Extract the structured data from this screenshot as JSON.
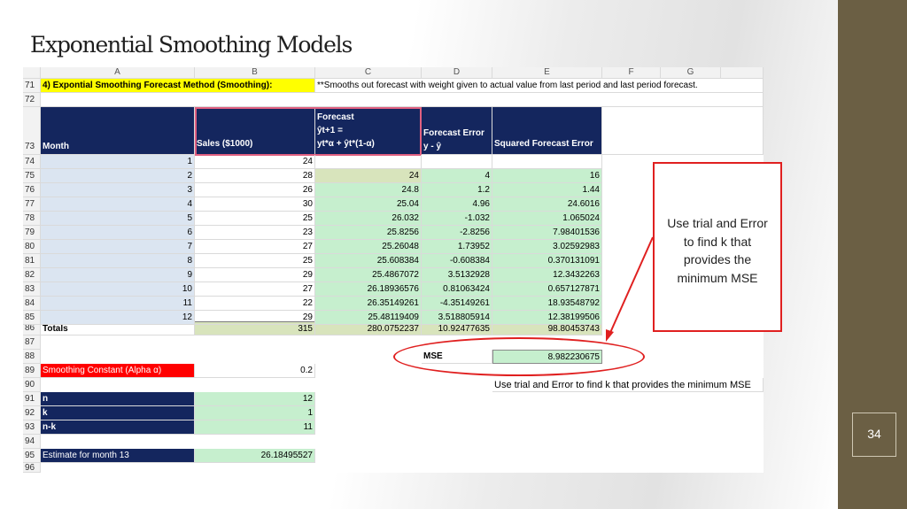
{
  "slide": {
    "title": "Exponential Smoothing Models",
    "page_number": "34",
    "callout_text": "Use trial and Error\nto find k that\nprovides the\nminimum MSE"
  },
  "sheet": {
    "columns": [
      "A",
      "B",
      "C",
      "D",
      "E",
      "F",
      "G"
    ],
    "row71": {
      "rn": "71",
      "title": "4) Expontial Smoothing Forecast Method (Smoothing):",
      "note": "**Smooths out forecast with weight given to actual value from last period and last period forecast."
    },
    "row72": "72",
    "row73": {
      "rn": "73",
      "month": "Month",
      "sales": "Sales ($1000)",
      "forecast_l1": "Forecast",
      "forecast_l2": "ŷt+1 =",
      "forecast_l3": "yt*α + ŷt*(1-α)",
      "error_l1": "Forecast Error",
      "error_l2": "y - ŷ",
      "sq": "Squared Forecast Error"
    },
    "data_rows": [
      {
        "rn": "74",
        "month": "1",
        "sales": "24",
        "forecast": "",
        "error": "",
        "sq": ""
      },
      {
        "rn": "75",
        "month": "2",
        "sales": "28",
        "forecast": "24",
        "error": "4",
        "sq": "16"
      },
      {
        "rn": "76",
        "month": "3",
        "sales": "26",
        "forecast": "24.8",
        "error": "1.2",
        "sq": "1.44"
      },
      {
        "rn": "77",
        "month": "4",
        "sales": "30",
        "forecast": "25.04",
        "error": "4.96",
        "sq": "24.6016"
      },
      {
        "rn": "78",
        "month": "5",
        "sales": "25",
        "forecast": "26.032",
        "error": "-1.032",
        "sq": "1.065024"
      },
      {
        "rn": "79",
        "month": "6",
        "sales": "23",
        "forecast": "25.8256",
        "error": "-2.8256",
        "sq": "7.98401536"
      },
      {
        "rn": "80",
        "month": "7",
        "sales": "27",
        "forecast": "25.26048",
        "error": "1.73952",
        "sq": "3.02592983"
      },
      {
        "rn": "81",
        "month": "8",
        "sales": "25",
        "forecast": "25.608384",
        "error": "-0.608384",
        "sq": "0.370131091"
      },
      {
        "rn": "82",
        "month": "9",
        "sales": "29",
        "forecast": "25.4867072",
        "error": "3.5132928",
        "sq": "12.3432263"
      },
      {
        "rn": "83",
        "month": "10",
        "sales": "27",
        "forecast": "26.18936576",
        "error": "0.81063424",
        "sq": "0.657127871"
      },
      {
        "rn": "84",
        "month": "11",
        "sales": "22",
        "forecast": "26.35149261",
        "error": "-4.35149261",
        "sq": "18.93548792"
      },
      {
        "rn": "85",
        "month": "12",
        "sales": "29",
        "forecast": "25.48119409",
        "error": "3.518805914",
        "sq": "12.38199506"
      }
    ],
    "totals": {
      "rn": "86",
      "label": "Totals",
      "sales": "315",
      "forecast": "280.0752237",
      "error": "10.92477635",
      "sq": "98.80453743"
    },
    "row87": "87",
    "row88": {
      "rn": "88",
      "label": "MSE",
      "value": "8.982230675"
    },
    "row89": {
      "rn": "89",
      "label": "Smoothing Constant (Alpha α)",
      "value": "0.2"
    },
    "row90": {
      "rn": "90",
      "note": "Use trial and Error to find k that provides the minimum MSE"
    },
    "row91": {
      "rn": "91",
      "label": "n",
      "value": "12"
    },
    "row92": {
      "rn": "92",
      "label": "k",
      "value": "1"
    },
    "row93": {
      "rn": "93",
      "label": "n-k",
      "value": "11"
    },
    "row94": "94",
    "row95": {
      "rn": "95",
      "label": "Estimate for month 13",
      "value": "26.18495527"
    },
    "row96": "96"
  },
  "colors": {
    "navy": "#14265e",
    "green": "#c6efce",
    "red": "#ff0000",
    "yellow": "#ffff00",
    "accent_bar": "#6b5f44"
  }
}
